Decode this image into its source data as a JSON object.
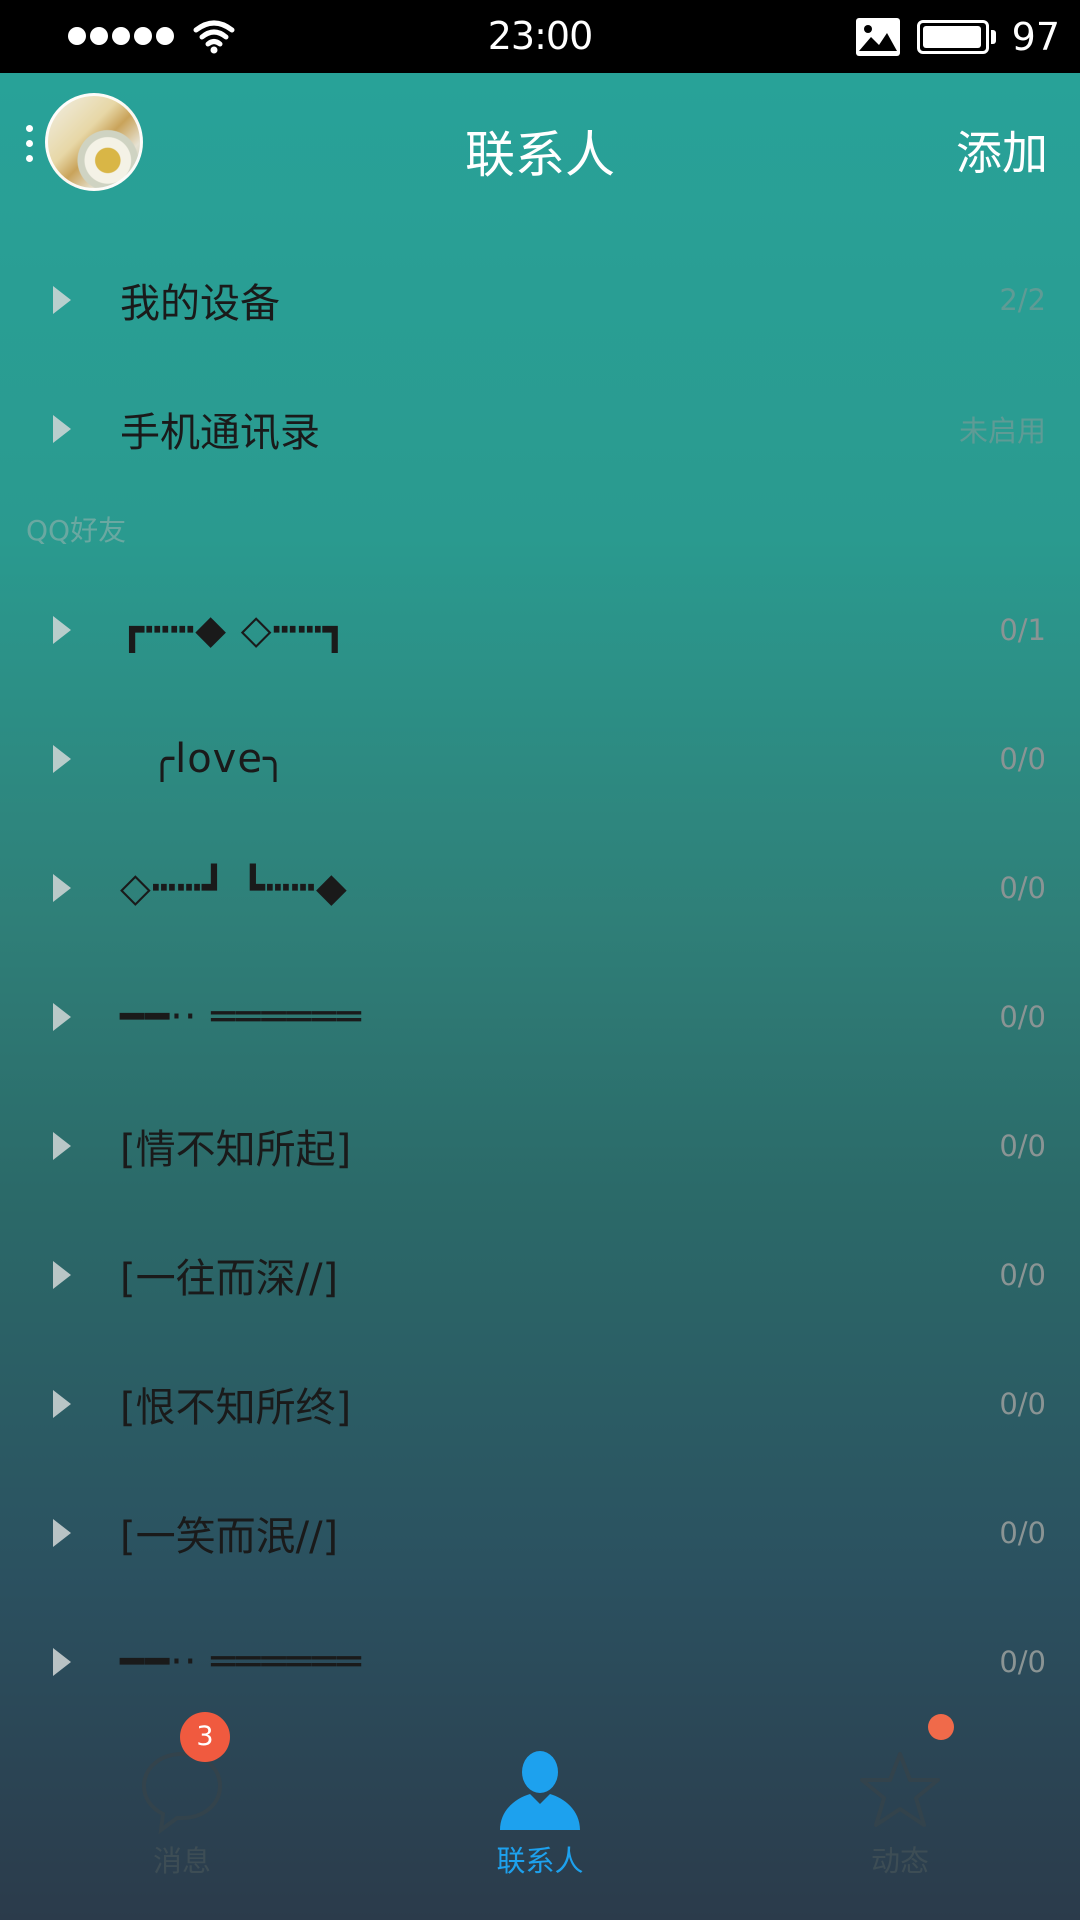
{
  "status_bar": {
    "time": "23:00",
    "battery": "97",
    "icons": [
      "signal-dots-icon",
      "wifi-icon",
      "image-icon",
      "battery-icon"
    ],
    "battery_level_percent": 97
  },
  "header": {
    "title": "联系人",
    "add_label": "添加"
  },
  "groups_top": [
    {
      "label": "我的设备",
      "count": "2/2"
    },
    {
      "label": "手机通讯录",
      "count": "未启用"
    }
  ],
  "section_title": "QQ好友",
  "friend_groups": [
    {
      "label": "┏┅┅◆ ◇┅┅┓",
      "count": "0/1"
    },
    {
      "label": "╭love╮",
      "count": "0/0"
    },
    {
      "label": "◇┅┅┛ ┗┅┅◆",
      "count": "0/0"
    },
    {
      "label": "━━·· ══════",
      "count": "0/0"
    },
    {
      "label": "[情不知所起]",
      "count": "0/0"
    },
    {
      "label": "[一往而深//]",
      "count": "0/0"
    },
    {
      "label": "[恨不知所终]",
      "count": "0/0"
    },
    {
      "label": "[一笑而泯//]",
      "count": "0/0"
    },
    {
      "label": "━━·· ══════",
      "count": "0/0"
    }
  ],
  "tabs": [
    {
      "label": "消息",
      "icon": "chat-bubble-icon",
      "badge": "3"
    },
    {
      "label": "联系人",
      "icon": "person-icon"
    },
    {
      "label": "动态",
      "icon": "star-icon"
    }
  ],
  "colors": {
    "accent": "#1da1ee",
    "badge": "#f05a3f"
  }
}
